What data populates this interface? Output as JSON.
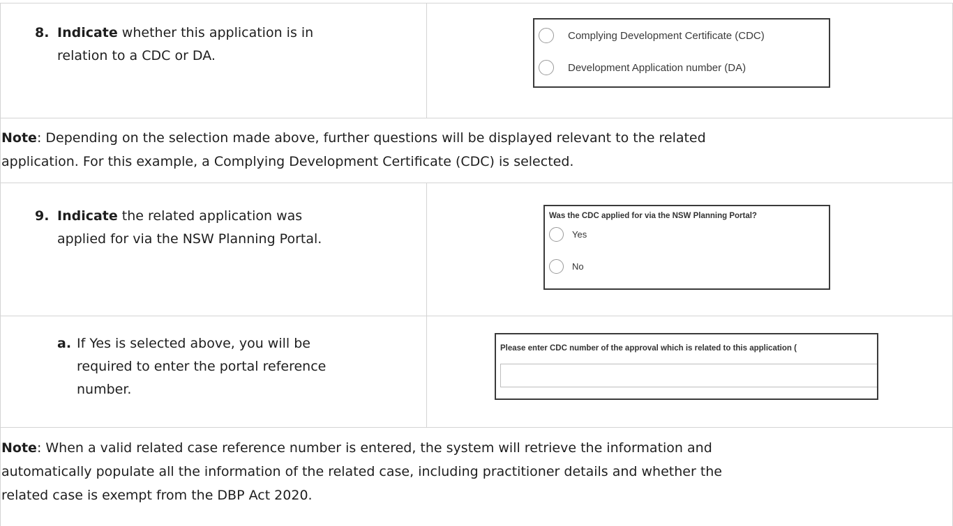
{
  "step8": {
    "number": "8.",
    "bold": "Indicate",
    "rest_line1": " whether this application is in",
    "line2": "relation to a CDC or DA.",
    "options": [
      "Complying Development Certificate (CDC)",
      "Development Application number (DA)"
    ]
  },
  "note1": {
    "label": "Note",
    "line1": ":  Depending on the selection made above, further questions will be displayed relevant to the related",
    "line2": "application. For this example, a Complying Development Certificate (CDC) is selected."
  },
  "step9": {
    "number": "9.",
    "bold": "Indicate",
    "rest_line1": " the related application was",
    "line2": "applied for via the NSW Planning Portal.",
    "question": "Was the CDC applied for via the NSW Planning Portal?",
    "options": [
      "Yes",
      "No"
    ]
  },
  "step9a": {
    "number": "a.",
    "line1": "If Yes is selected above, you will be",
    "line2": "required to enter the portal reference",
    "line3": "number.",
    "field_label": "Please enter CDC number of the approval which is related to this application (",
    "field_value": ""
  },
  "note2": {
    "label": "Note",
    "line1": ":  When a valid related case reference number is entered, the system will retrieve the information and",
    "line2": "automatically populate all the information of the related case, including practitioner details and whether the",
    "line3": "related case is exempt from the DBP Act 2020."
  }
}
